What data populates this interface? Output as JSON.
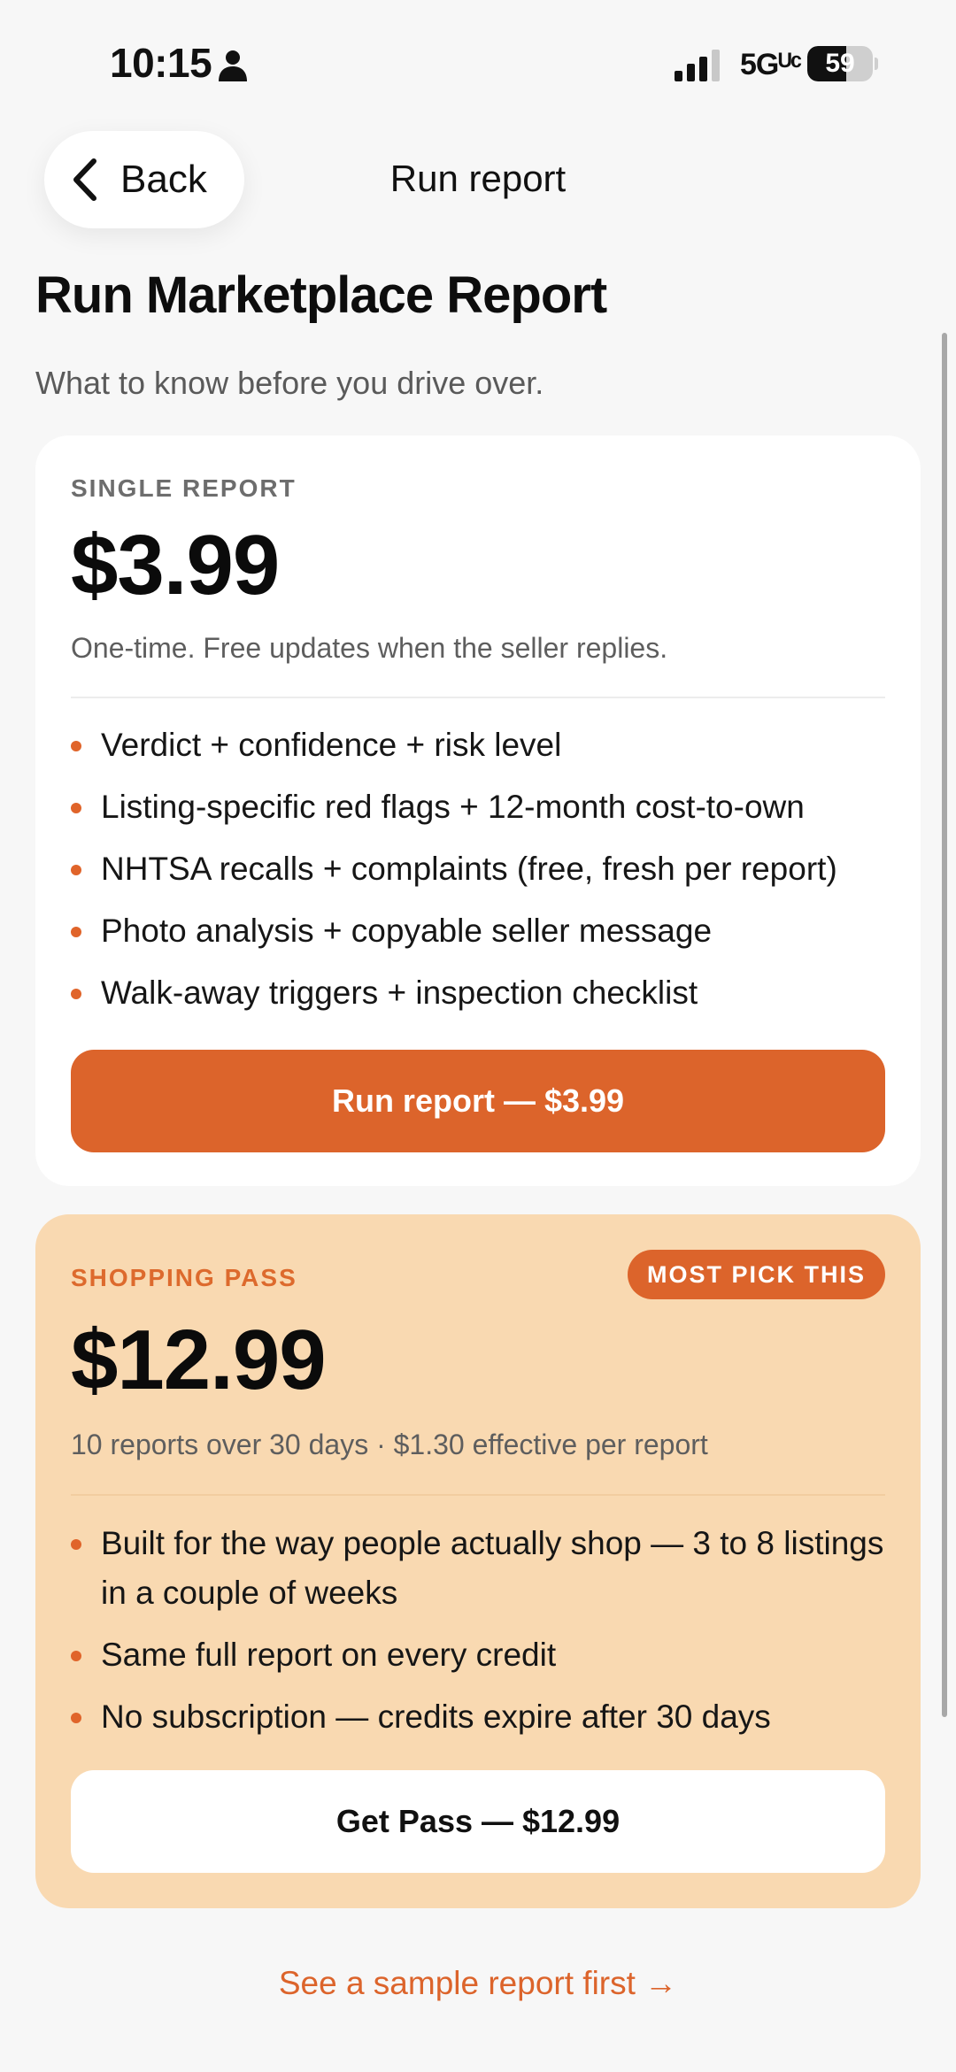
{
  "status_bar": {
    "time": "10:15",
    "network": "5Gᵁᶜ",
    "battery": "59",
    "battery_level": 0.59
  },
  "nav": {
    "back_label": "Back",
    "title": "Run report"
  },
  "header": {
    "title": "Run Marketplace Report",
    "subtitle": "What to know before you drive over."
  },
  "single": {
    "label": "SINGLE REPORT",
    "price": "$3.99",
    "note": "One-time. Free updates when the seller replies.",
    "features": [
      "Verdict + confidence + risk level",
      "Listing-specific red flags + 12-month cost-to-own",
      "NHTSA recalls + complaints (free, fresh per report)",
      "Photo analysis + copyable seller message",
      "Walk-away triggers + inspection checklist"
    ],
    "cta": "Run report — $3.99"
  },
  "pass": {
    "label": "SHOPPING PASS",
    "badge": "MOST PICK THIS",
    "price": "$12.99",
    "note": "10 reports over 30 days · $1.30 effective per report",
    "features": [
      "Built for the way people actually shop — 3 to 8 listings in a couple of weeks",
      "Same full report on every credit",
      "No subscription — credits expire after 30 days"
    ],
    "cta": "Get Pass — $12.99"
  },
  "sample_link": "See a sample report first →",
  "colors": {
    "accent": "#dc642b",
    "pass_card_bg": "#f9d9b1",
    "page_bg": "#f7f7f7"
  }
}
